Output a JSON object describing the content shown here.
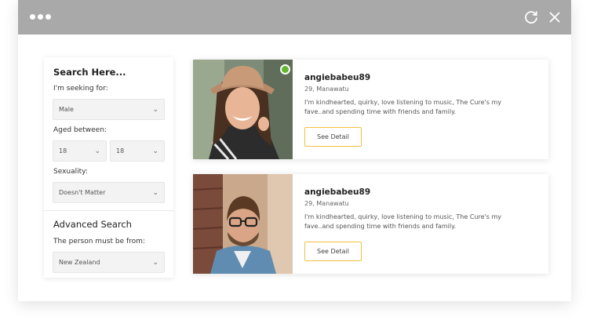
{
  "window": {
    "icons": [
      "menu-dots-icon",
      "refresh-icon",
      "close-icon"
    ]
  },
  "sidebar": {
    "title": "Search Here...",
    "seeking_label": "I'm seeking for:",
    "seeking_value": "Male",
    "aged_label": "Aged between:",
    "age_from": "18",
    "age_to": "18",
    "sexuality_label": "Sexuality:",
    "sexuality_value": "Doesn't Matter",
    "advanced_title": "Advanced Search",
    "from_label": "The person must be from:",
    "from_value": "New Zealand"
  },
  "profiles": [
    {
      "username": "angiebabeu89",
      "location": "29, Manawatu",
      "bio": "I'm kindhearted, quirky, love listening to music, The Cure's my fave..and spending time with friends and family.",
      "button": "See Detail",
      "online": true
    },
    {
      "username": "angiebabeu89",
      "location": "29, Manawatu",
      "bio": "I'm kindhearted, quirky, love listening to music, The Cure's my fave..and spending time with friends and family.",
      "button": "See Detail",
      "online": false
    }
  ],
  "colors": {
    "titlebar": "#a9a9a9",
    "accent": "#f0c040",
    "online": "#62b72d"
  }
}
